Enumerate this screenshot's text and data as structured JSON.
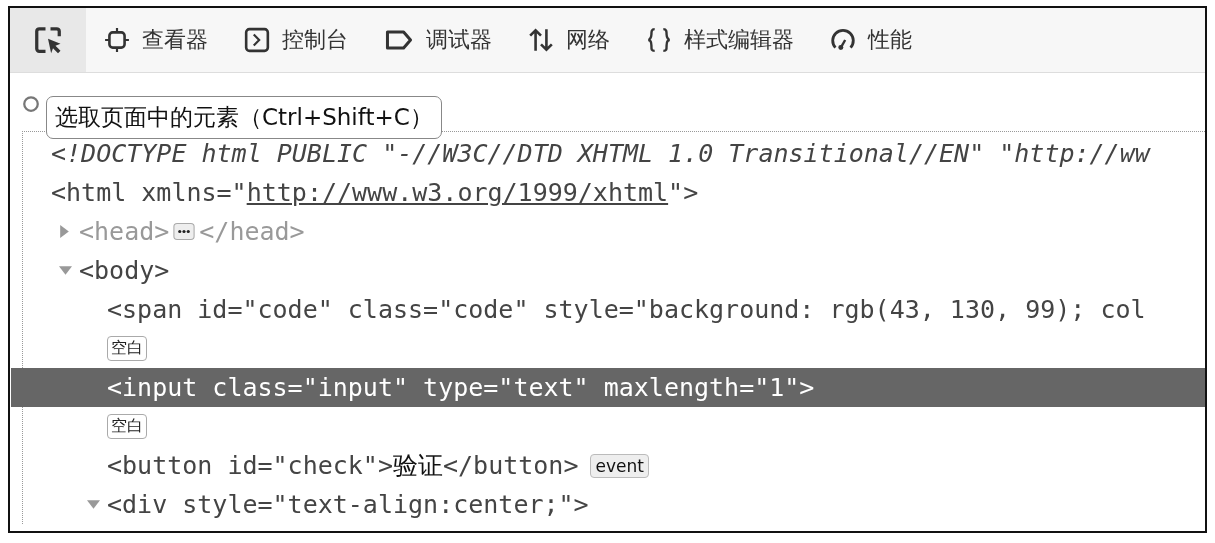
{
  "toolbar": {
    "picker": {
      "selected": true
    },
    "tabs": [
      {
        "label": "查看器",
        "kind": "inspector",
        "selected": false
      },
      {
        "label": "控制台",
        "kind": "console",
        "selected": false
      },
      {
        "label": "调试器",
        "kind": "debugger",
        "selected": false
      },
      {
        "label": "网络",
        "kind": "network",
        "selected": false
      },
      {
        "label": "样式编辑器",
        "kind": "style",
        "selected": false
      },
      {
        "label": "性能",
        "kind": "performance",
        "selected": false
      }
    ]
  },
  "tooltip": "选取页面中的元素（Ctrl+Shift+C）",
  "tree": [
    {
      "kind": "doctype",
      "text": "<!DOCTYPE html PUBLIC \"-//W3C//DTD XHTML 1.0 Transitional//EN\" \"http://ww",
      "selected": false
    },
    {
      "kind": "element",
      "text": "<html xmlns=\"",
      "link": "http://www.w3.org/1999/xhtml",
      "after": "\">",
      "selected": false,
      "children": [
        {
          "kind": "element",
          "text": "<head>",
          "expanded": false,
          "closing": "</head>",
          "selected": false
        },
        {
          "kind": "element",
          "text": "<body>",
          "expanded": true,
          "selected": false,
          "children": [
            {
              "kind": "element",
              "text": "<span id=\"code\" class=\"code\" style=\"background: rgb(43, 130, 99); col",
              "selected": false
            },
            {
              "kind": "whitespace",
              "text": "空白",
              "selected": false
            },
            {
              "kind": "element",
              "text": "<input class=\"input\" type=\"text\" maxlength=\"1\">",
              "selected": true
            },
            {
              "kind": "whitespace",
              "text": "空白",
              "selected": false
            },
            {
              "kind": "element",
              "text": "<button id=\"check\">",
              "content": "验证",
              "after": "</button>",
              "badge": "event",
              "selected": false
            },
            {
              "kind": "element",
              "text": "<div style=\"text-align:center;\">",
              "expanded": true,
              "selected": false
            }
          ]
        }
      ]
    }
  ]
}
